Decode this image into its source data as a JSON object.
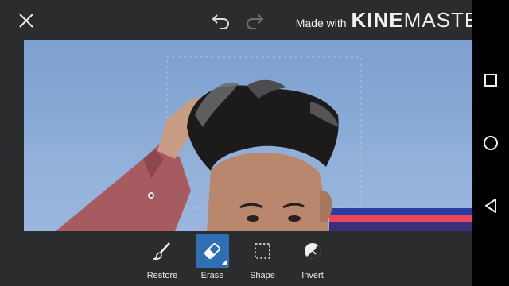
{
  "topbar": {
    "close_icon": "close-icon",
    "undo_icon": "undo-icon",
    "redo_icon": "redo-icon"
  },
  "watermark": {
    "prefix": "Made with",
    "brand_bold": "KINE",
    "brand_light": "MASTER"
  },
  "tools": [
    {
      "label": "Restore",
      "icon": "brush-icon",
      "active": false
    },
    {
      "label": "Erase",
      "icon": "eraser-icon",
      "active": true
    },
    {
      "label": "Shape",
      "icon": "dashed-square-icon",
      "active": false
    },
    {
      "label": "Invert",
      "icon": "invert-icon",
      "active": false
    }
  ],
  "navbar": {
    "recents_icon": "square-icon",
    "home_icon": "circle-icon",
    "back_icon": "triangle-back-icon"
  },
  "colors": {
    "toolbar_bg": "#2b2c2e",
    "active_tool": "#2f6fb3",
    "sky": "#8aabd6"
  }
}
